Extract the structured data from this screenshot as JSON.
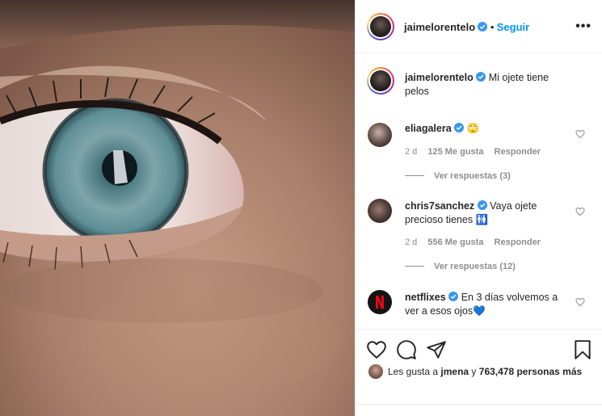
{
  "post": {
    "author": "jaimelorentelo",
    "follow_label": "Seguir",
    "separator": "•",
    "more_label": "•••",
    "caption": "Mi ojete tiene pelos"
  },
  "comments": [
    {
      "username": "eliagalera",
      "text": "🙄",
      "age": "2 d",
      "likes": "125 Me gusta",
      "reply": "Responder",
      "view_replies": "Ver respuestas (3)"
    },
    {
      "username": "chris7sanchez",
      "text": "Vaya ojete precioso tienes 🚻",
      "age": "2 d",
      "likes": "556 Me gusta",
      "reply": "Responder",
      "view_replies": "Ver respuestas (12)"
    },
    {
      "username": "netflixes",
      "text": "En 3 días volvemos a ver a esos ojos💙"
    }
  ],
  "likes_bar": {
    "prefix": "Les gusta a",
    "user": "jmena",
    "middle": "y",
    "count": "763,478 personas más"
  },
  "colors": {
    "accent": "#0095f6",
    "verified": "#3897f0",
    "netflix": "#e50914",
    "muted": "#8e8e8e"
  },
  "icons": [
    "heart-icon",
    "comment-icon",
    "share-icon",
    "bookmark-icon",
    "verified-icon",
    "more-icon"
  ]
}
